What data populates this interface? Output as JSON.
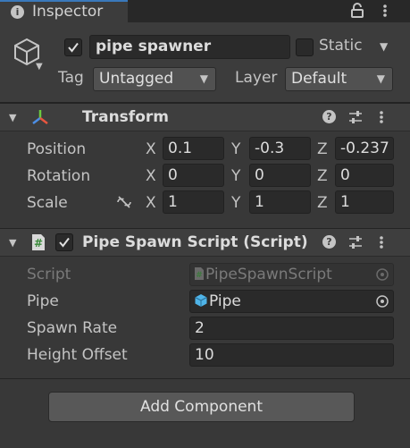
{
  "tab": {
    "label": "Inspector"
  },
  "gameobject": {
    "active": true,
    "name": "pipe spawner",
    "static_label": "Static",
    "is_static": false,
    "tag_label": "Tag",
    "tag_value": "Untagged",
    "layer_label": "Layer",
    "layer_value": "Default"
  },
  "transform": {
    "title": "Transform",
    "rows": [
      {
        "label": "Position",
        "x": "0.1",
        "y": "-0.3",
        "z": "-0.237"
      },
      {
        "label": "Rotation",
        "x": "0",
        "y": "0",
        "z": "0"
      },
      {
        "label": "Scale",
        "x": "1",
        "y": "1",
        "z": "1"
      }
    ],
    "axes": {
      "x": "X",
      "y": "Y",
      "z": "Z"
    }
  },
  "script_component": {
    "title": "Pipe Spawn Script (Script)",
    "enabled": true,
    "fields": {
      "script_label": "Script",
      "script_value": "PipeSpawnScript",
      "pipe_label": "Pipe",
      "pipe_value": "Pipe",
      "spawn_rate_label": "Spawn Rate",
      "spawn_rate_value": "2",
      "height_offset_label": "Height Offset",
      "height_offset_value": "10"
    }
  },
  "add_component_label": "Add Component",
  "colors": {
    "tab_accent": "#3a79bb",
    "panel_bg": "#383838",
    "header_bg": "#3e3e3e",
    "field_bg": "#2a2a2a",
    "button_bg": "#585858",
    "prefab_blue": "#4fb4e8"
  },
  "icons": {
    "tab": "info-icon",
    "lock": "lock-icon",
    "menu": "kebab-menu-icon",
    "gameobject": "cube-icon",
    "transform": "transform-axes-icon",
    "script": "csharp-script-icon",
    "prefab": "prefab-cube-icon",
    "help": "help-icon",
    "presets": "presets-icon",
    "link": "unlink-scale-icon",
    "picker": "object-picker-icon"
  }
}
